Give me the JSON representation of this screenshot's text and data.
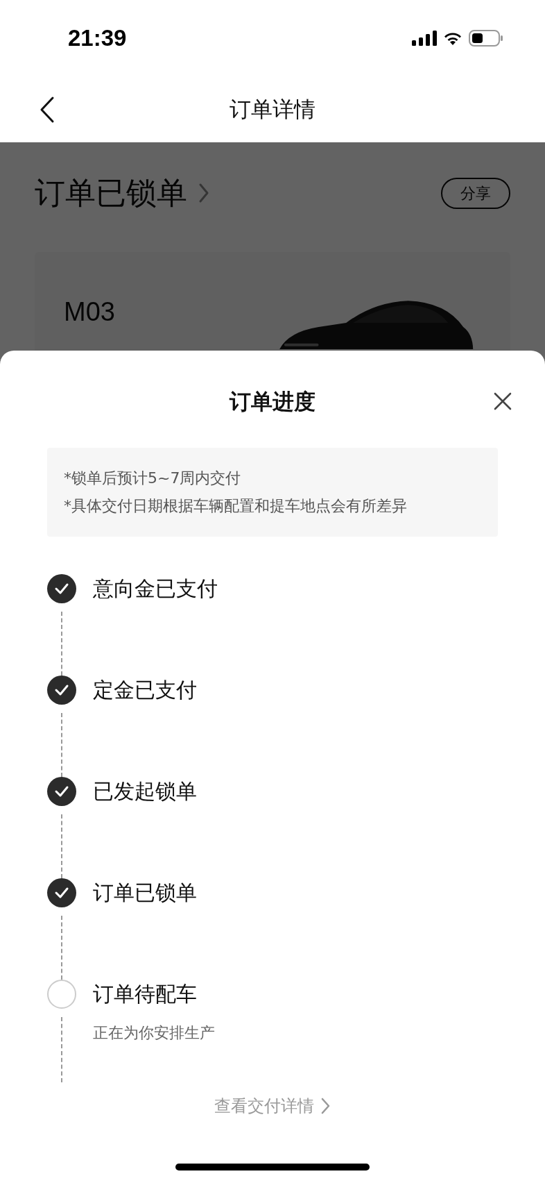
{
  "status_bar": {
    "time": "21:39"
  },
  "nav": {
    "title": "订单详情"
  },
  "order_header": {
    "status": "订单已锁单",
    "share": "分享"
  },
  "card": {
    "model": "M03"
  },
  "sheet": {
    "title": "订单进度",
    "notes": [
      "*锁单后预计5~7周内交付",
      "*具体交付日期根据车辆配置和提车地点会有所差异"
    ],
    "steps": [
      {
        "label": "意向金已支付",
        "done": true
      },
      {
        "label": "定金已支付",
        "done": true
      },
      {
        "label": "已发起锁单",
        "done": true
      },
      {
        "label": "订单已锁单",
        "done": true
      },
      {
        "label": "订单待配车",
        "done": false,
        "note": "正在为你安排生产"
      }
    ],
    "link": "查看交付详情"
  }
}
